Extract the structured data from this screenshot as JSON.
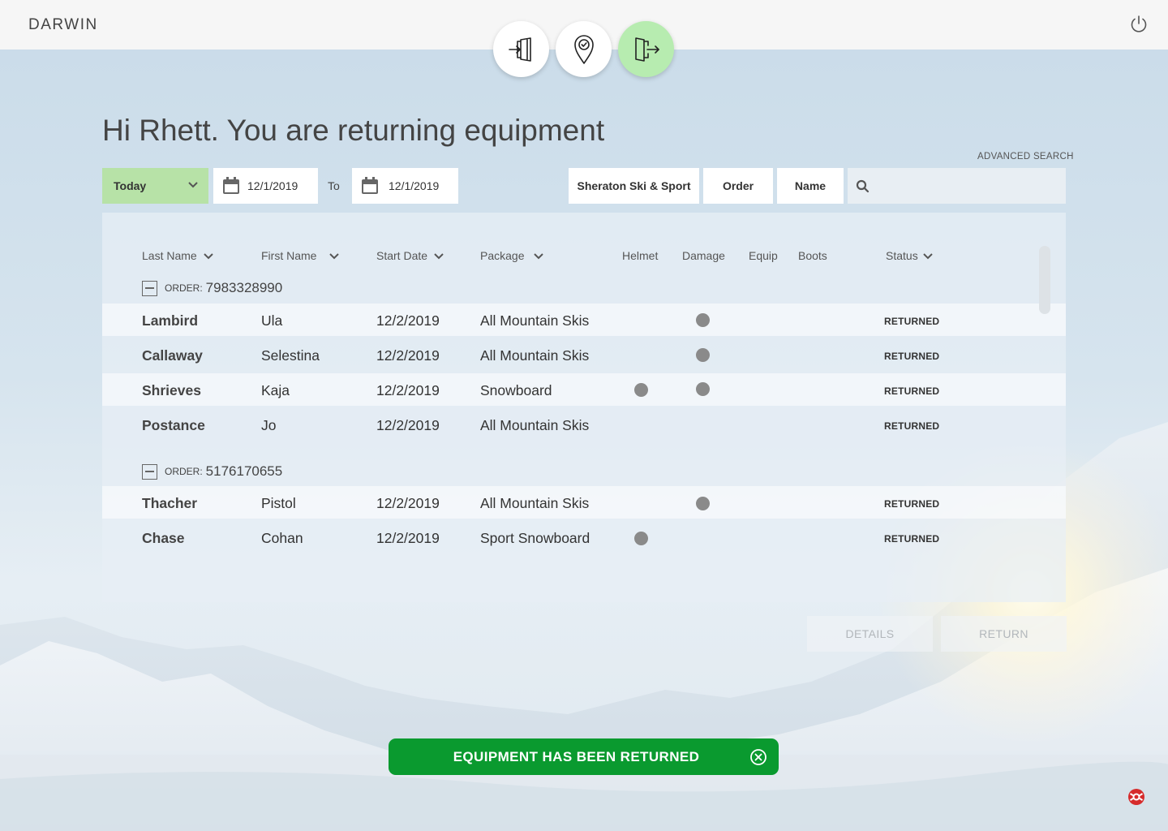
{
  "app": {
    "brand": "DARWIN"
  },
  "steps": [
    {
      "name": "check-in",
      "icon": "door-enter-icon",
      "active": false
    },
    {
      "name": "location",
      "icon": "map-pin-check-icon",
      "active": false
    },
    {
      "name": "return",
      "icon": "door-exit-icon",
      "active": true
    }
  ],
  "greeting": "Hi Rhett. You are returning equipment",
  "advanced_search": "ADVANCED SEARCH",
  "filters": {
    "period": "Today",
    "date_from": "12/1/2019",
    "to_label": "To",
    "date_to": "12/1/2019",
    "location": "Sheraton Ski & Sport",
    "order_label": "Order",
    "name_label": "Name",
    "search_placeholder": ""
  },
  "columns": {
    "last_name": "Last Name",
    "first_name": "First Name",
    "start_date": "Start Date",
    "package": "Package",
    "helmet": "Helmet",
    "damage": "Damage",
    "equip": "Equip",
    "boots": "Boots",
    "status": "Status"
  },
  "order_prefix": "ORDER:",
  "orders": [
    {
      "number": "7983328990",
      "rows": [
        {
          "last": "Lambird",
          "first": "Ula",
          "start": "12/2/2019",
          "package": "All Mountain Skis",
          "helmet": false,
          "damage": true,
          "status": "RETURNED"
        },
        {
          "last": "Callaway",
          "first": "Selestina",
          "start": "12/2/2019",
          "package": "All Mountain Skis",
          "helmet": false,
          "damage": true,
          "status": "RETURNED"
        },
        {
          "last": "Shrieves",
          "first": "Kaja",
          "start": "12/2/2019",
          "package": "Snowboard",
          "helmet": true,
          "damage": true,
          "status": "RETURNED"
        },
        {
          "last": "Postance",
          "first": "Jo",
          "start": "12/2/2019",
          "package": "All Mountain Skis",
          "helmet": false,
          "damage": false,
          "status": "RETURNED"
        }
      ]
    },
    {
      "number": "5176170655",
      "rows": [
        {
          "last": "Thacher",
          "first": "Pistol",
          "start": "12/2/2019",
          "package": "All Mountain Skis",
          "helmet": false,
          "damage": true,
          "status": "RETURNED"
        },
        {
          "last": "Chase",
          "first": "Cohan",
          "start": "12/2/2019",
          "package": "Sport Snowboard",
          "helmet": true,
          "damage": false,
          "status": "RETURNED"
        }
      ]
    }
  ],
  "actions": {
    "details": "DETAILS",
    "return": "RETURN"
  },
  "toast": "EQUIPMENT HAS BEEN RETURNED",
  "colors": {
    "accent_green": "#b7e2a7",
    "toast_green": "#0a9a2f",
    "active_step": "#b7ecb0",
    "help_red": "#d62b2b"
  }
}
